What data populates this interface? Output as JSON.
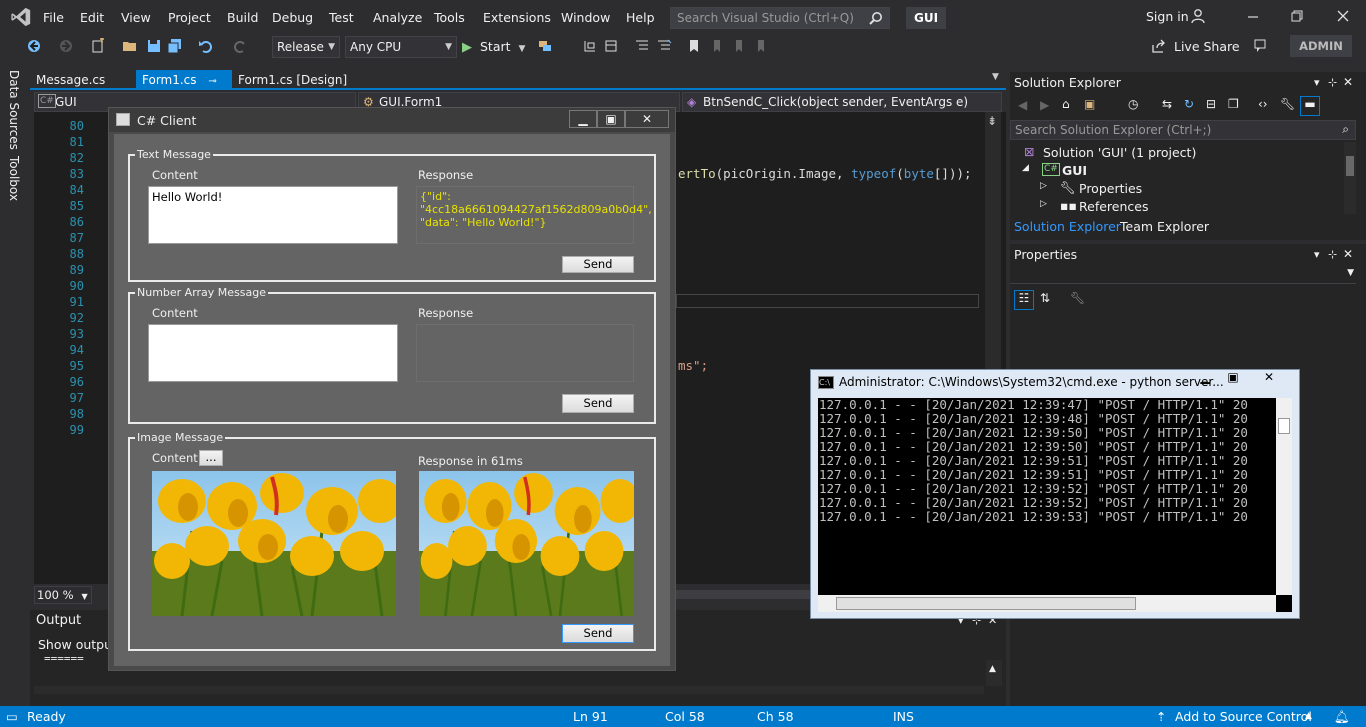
{
  "menu": [
    "File",
    "Edit",
    "View",
    "Project",
    "Build",
    "Debug",
    "Test",
    "Analyze",
    "Tools",
    "Extensions",
    "Window",
    "Help"
  ],
  "search": {
    "placeholder": "Search Visual Studio (Ctrl+Q)"
  },
  "solution_badge": "GUI",
  "signin": "Sign in",
  "toolbar": {
    "config": "Release",
    "platform": "Any CPU",
    "start": "Start",
    "liveshare": "Live Share",
    "admin": "ADMIN"
  },
  "left_tabs": [
    "Data Sources",
    "Toolbox"
  ],
  "doc_tabs": [
    "Message.cs",
    "Form1.cs",
    "Form1.cs [Design]"
  ],
  "nav": {
    "project": "GUI",
    "class": "GUI.Form1",
    "member": "BtnSendC_Click(object sender, EventArgs e)"
  },
  "line_numbers": [
    "80",
    "81",
    "82",
    "83",
    "84",
    "85",
    "86",
    "87",
    "88",
    "89",
    "90",
    "91",
    "92",
    "93",
    "94",
    "95",
    "96",
    "97",
    "98",
    "99"
  ],
  "code_fragments": {
    "line83_pre": "ertTo",
    "line83_a": "(picOrigin.Image, ",
    "line83_kw1": "typeof",
    "line83_b": "(",
    "line83_kw2": "byte",
    "line83_c": "[]));",
    "line95": "ms\";"
  },
  "zoom": "100 %",
  "output": {
    "title": "Output",
    "show_output": "Show outpu",
    "separator": "======"
  },
  "solution_explorer": {
    "title": "Solution Explorer",
    "search_placeholder": "Search Solution Explorer (Ctrl+;)",
    "items": [
      "Solution 'GUI' (1 project)",
      "GUI",
      "Properties",
      "References"
    ],
    "tabs": [
      "Solution Explorer",
      "Team Explorer"
    ]
  },
  "properties": {
    "title": "Properties"
  },
  "client": {
    "title": "C# Client",
    "text_group": {
      "title": "Text Message",
      "content_label": "Content",
      "content_value": "Hello World!",
      "response_label": "Response",
      "response_value": "{\"id\": \"4cc18a6661094427af1562d809a0b0d4\", \"data\": \"Hello World!\"}",
      "send": "Send"
    },
    "number_group": {
      "title": "Number Array Message",
      "content_label": "Content",
      "response_label": "Response",
      "send": "Send"
    },
    "image_group": {
      "title": "Image Message",
      "content_label": "Content",
      "browse": "...",
      "response_label": "Response in 61ms",
      "send": "Send"
    }
  },
  "cmd": {
    "title": "Administrator: C:\\Windows\\System32\\cmd.exe - python  server...",
    "lines": [
      "127.0.0.1 - - [20/Jan/2021 12:39:47] \"POST / HTTP/1.1\" 20",
      "127.0.0.1 - - [20/Jan/2021 12:39:48] \"POST / HTTP/1.1\" 20",
      "127.0.0.1 - - [20/Jan/2021 12:39:50] \"POST / HTTP/1.1\" 20",
      "127.0.0.1 - - [20/Jan/2021 12:39:50] \"POST / HTTP/1.1\" 20",
      "127.0.0.1 - - [20/Jan/2021 12:39:51] \"POST / HTTP/1.1\" 20",
      "127.0.0.1 - - [20/Jan/2021 12:39:51] \"POST / HTTP/1.1\" 20",
      "127.0.0.1 - - [20/Jan/2021 12:39:52] \"POST / HTTP/1.1\" 20",
      "127.0.0.1 - - [20/Jan/2021 12:39:52] \"POST / HTTP/1.1\" 20",
      "127.0.0.1 - - [20/Jan/2021 12:39:53] \"POST / HTTP/1.1\" 20"
    ]
  },
  "status": {
    "ready": "Ready",
    "ln": "Ln 91",
    "col": "Col 58",
    "ch": "Ch 58",
    "ins": "INS",
    "source_control": "Add to Source Control"
  },
  "colors": {
    "accent": "#007acc",
    "editor_bg": "#1e1e1e",
    "line_number": "#2b91af",
    "keyword": "#569cd6",
    "string": "#d69d85",
    "response_text": "#e8e200"
  }
}
